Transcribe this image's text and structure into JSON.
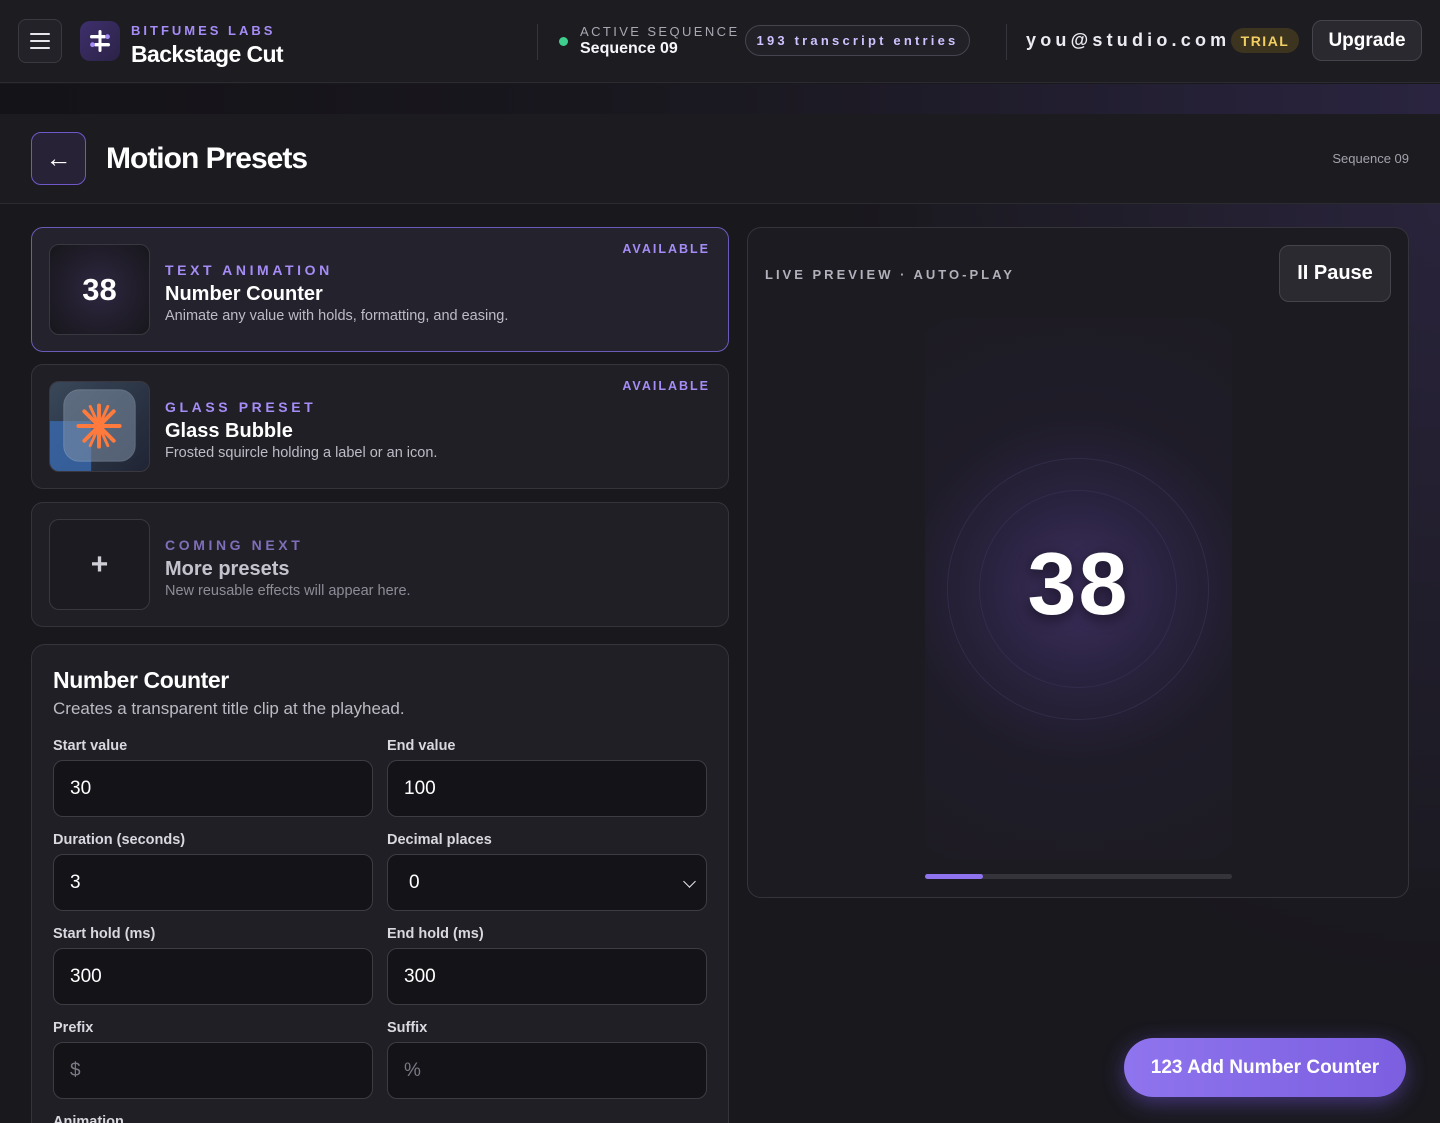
{
  "topbar": {
    "brand_sub": "BITFUMES LABS",
    "brand_title": "Backstage Cut",
    "sequence_label": "ACTIVE SEQUENCE",
    "sequence_value": "Sequence 09",
    "transcript_pill": "193 transcript entries",
    "user_email": "you@studio.com",
    "trial_badge": "TRIAL",
    "upgrade_label": "Upgrade"
  },
  "page_header": {
    "back_icon": "←",
    "title": "Motion Presets",
    "sequence": "Sequence 09"
  },
  "presets": [
    {
      "kicker": "TEXT ANIMATION",
      "title": "Number Counter",
      "description": "Animate any value with holds, formatting, and easing.",
      "status": "AVAILABLE",
      "thumb_text": "38"
    },
    {
      "kicker": "GLASS PRESET",
      "title": "Glass Bubble",
      "description": "Frosted squircle holding a label or an icon.",
      "status": "AVAILABLE"
    },
    {
      "kicker": "COMING NEXT",
      "title": "More presets",
      "description": "New reusable effects will appear here.",
      "thumb_text": "+"
    }
  ],
  "form": {
    "title": "Number Counter",
    "subtitle": "Creates a transparent title clip at the playhead.",
    "start_value": {
      "label": "Start value",
      "value": "30"
    },
    "end_value": {
      "label": "End value",
      "value": "100"
    },
    "duration": {
      "label": "Duration (seconds)",
      "value": "3"
    },
    "decimals": {
      "label": "Decimal places",
      "value": "0"
    },
    "start_hold": {
      "label": "Start hold (ms)",
      "value": "300"
    },
    "end_hold": {
      "label": "End hold (ms)",
      "value": "300"
    },
    "prefix": {
      "label": "Prefix",
      "placeholder": "$"
    },
    "suffix": {
      "label": "Suffix",
      "placeholder": "%"
    },
    "animation_label": "Animation"
  },
  "preview": {
    "label": "LIVE PREVIEW · AUTO-PLAY",
    "pause_label": "II Pause",
    "current_number": "38",
    "progress": 0.19
  },
  "add_button_label": "123 Add Number Counter",
  "colors": {
    "accent": "#8f72ee",
    "kicker": "#a58cf6",
    "status_green": "#3ecf8e",
    "trial": "#f2cf63"
  }
}
